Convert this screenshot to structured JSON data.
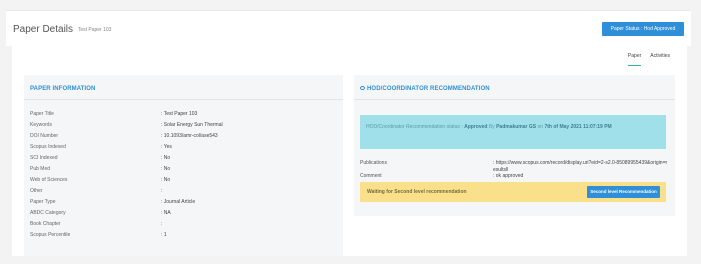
{
  "header": {
    "title": "Paper Details",
    "subtitle": "Test Paper 103",
    "status_button": "Paper Status : Hod Approved"
  },
  "tabs": [
    {
      "label": "Paper",
      "active": true
    },
    {
      "label": "Activities",
      "active": false
    }
  ],
  "paper_info": {
    "title": "PAPER INFORMATION",
    "rows": [
      {
        "label": "Paper Title",
        "value": ": Test Paper 103"
      },
      {
        "label": "Keywords",
        "value": ": Solar Energy Sun Thermal"
      },
      {
        "label": "DOI Number",
        "value": ": 10.1093/amr-col/ase543"
      },
      {
        "label": "Scopus Indexed",
        "value": ": Yes"
      },
      {
        "label": "SCI Indexed",
        "value": ": No"
      },
      {
        "label": "Pub Med",
        "value": ": No"
      },
      {
        "label": "Web of Sciences",
        "value": ": No"
      },
      {
        "label": "Other",
        "value": ":"
      },
      {
        "label": "Paper Type",
        "value": ": Journal Article"
      },
      {
        "label": "ABDC Category",
        "value": ": NA"
      },
      {
        "label": "Book Chapter",
        "value": ":"
      },
      {
        "label": "Scopus Percentile",
        "value": ": 1"
      }
    ]
  },
  "recommendation": {
    "title": "HOD/COORDINATOR RECOMMENDATION",
    "status_prefix": "HOD/Coordinator Recommendation status :",
    "status": "Approved",
    "by_text": "By",
    "by": "Padmakumar GS",
    "on_text": "on",
    "date": "7th of May 2021 11:07:19 PM",
    "publications_label": "Publications",
    "publications_value": ": https://www.scopus.com/record/display.uri?eid=2-s2.0-85089955439&origin=resultsll",
    "comment_label": "Comment",
    "comment_value": ": ok approved",
    "waiting_text": "Waiting for Second level recommendation",
    "second_button": "Second level Recommendation"
  },
  "colors": {
    "accent": "#2f8fd8",
    "info_bg": "#9fe0ea",
    "warning_bg": "#fbe08c",
    "tab_active": "#2fb5a6"
  }
}
